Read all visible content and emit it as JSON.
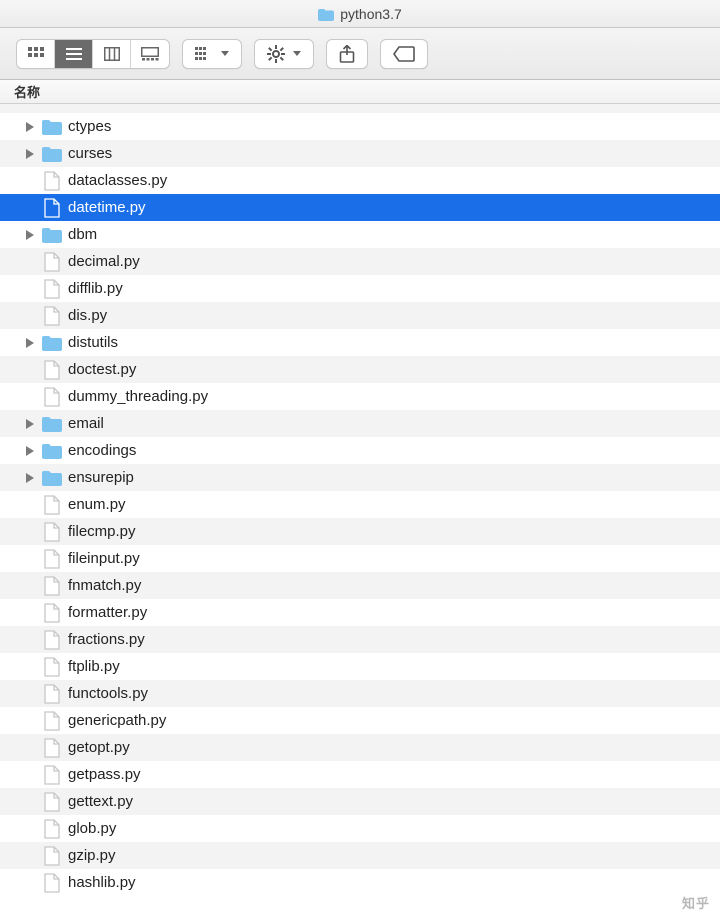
{
  "window": {
    "title": "python3.7"
  },
  "toolbar": {
    "views": [
      "icon-view",
      "list-view",
      "column-view",
      "gallery-view"
    ],
    "active_view_index": 1
  },
  "columns": {
    "name": "名称"
  },
  "watermark": "知乎",
  "items": [
    {
      "name": "ctypes",
      "type": "folder",
      "expandable": true,
      "selected": false
    },
    {
      "name": "curses",
      "type": "folder",
      "expandable": true,
      "selected": false
    },
    {
      "name": "dataclasses.py",
      "type": "file",
      "expandable": false,
      "selected": false
    },
    {
      "name": "datetime.py",
      "type": "file",
      "expandable": false,
      "selected": true
    },
    {
      "name": "dbm",
      "type": "folder",
      "expandable": true,
      "selected": false
    },
    {
      "name": "decimal.py",
      "type": "file",
      "expandable": false,
      "selected": false
    },
    {
      "name": "difflib.py",
      "type": "file",
      "expandable": false,
      "selected": false
    },
    {
      "name": "dis.py",
      "type": "file",
      "expandable": false,
      "selected": false
    },
    {
      "name": "distutils",
      "type": "folder",
      "expandable": true,
      "selected": false
    },
    {
      "name": "doctest.py",
      "type": "file",
      "expandable": false,
      "selected": false
    },
    {
      "name": "dummy_threading.py",
      "type": "file",
      "expandable": false,
      "selected": false
    },
    {
      "name": "email",
      "type": "folder",
      "expandable": true,
      "selected": false
    },
    {
      "name": "encodings",
      "type": "folder",
      "expandable": true,
      "selected": false
    },
    {
      "name": "ensurepip",
      "type": "folder",
      "expandable": true,
      "selected": false
    },
    {
      "name": "enum.py",
      "type": "file",
      "expandable": false,
      "selected": false
    },
    {
      "name": "filecmp.py",
      "type": "file",
      "expandable": false,
      "selected": false
    },
    {
      "name": "fileinput.py",
      "type": "file",
      "expandable": false,
      "selected": false
    },
    {
      "name": "fnmatch.py",
      "type": "file",
      "expandable": false,
      "selected": false
    },
    {
      "name": "formatter.py",
      "type": "file",
      "expandable": false,
      "selected": false
    },
    {
      "name": "fractions.py",
      "type": "file",
      "expandable": false,
      "selected": false
    },
    {
      "name": "ftplib.py",
      "type": "file",
      "expandable": false,
      "selected": false
    },
    {
      "name": "functools.py",
      "type": "file",
      "expandable": false,
      "selected": false
    },
    {
      "name": "genericpath.py",
      "type": "file",
      "expandable": false,
      "selected": false
    },
    {
      "name": "getopt.py",
      "type": "file",
      "expandable": false,
      "selected": false
    },
    {
      "name": "getpass.py",
      "type": "file",
      "expandable": false,
      "selected": false
    },
    {
      "name": "gettext.py",
      "type": "file",
      "expandable": false,
      "selected": false
    },
    {
      "name": "glob.py",
      "type": "file",
      "expandable": false,
      "selected": false
    },
    {
      "name": "gzip.py",
      "type": "file",
      "expandable": false,
      "selected": false
    },
    {
      "name": "hashlib.py",
      "type": "file",
      "expandable": false,
      "selected": false
    }
  ]
}
